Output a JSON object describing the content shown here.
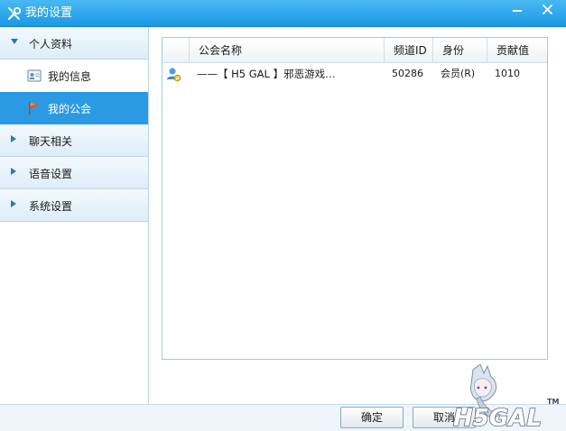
{
  "window": {
    "title": "我的设置"
  },
  "sidebar": {
    "sections": [
      {
        "label": "个人资料",
        "expanded": true
      },
      {
        "label": "聊天相关",
        "expanded": false
      },
      {
        "label": "语音设置",
        "expanded": false
      },
      {
        "label": "系统设置",
        "expanded": false
      }
    ],
    "sub_items": [
      {
        "label": "我的信息",
        "icon": "profile-card-icon",
        "selected": false
      },
      {
        "label": "我的公会",
        "icon": "guild-flag-icon",
        "selected": true
      }
    ],
    "selected_color": "#2b9ae3"
  },
  "guild_table": {
    "columns": [
      "",
      "公会名称",
      "频道ID",
      "身份",
      "贡献值"
    ],
    "rows": [
      {
        "icon": "guild-member-icon",
        "name": "——【 H5 GAL 】邪恶游戏…",
        "channel_id": "50286",
        "role": "会员(R)",
        "contribution": "1010"
      }
    ]
  },
  "footer": {
    "ok_label": "确定",
    "cancel_label": "取消"
  },
  "logo": {
    "text": "H5GAL",
    "tm": "TM"
  },
  "colors": {
    "titlebar": "#1a98e6",
    "accent": "#2b9ae3"
  }
}
